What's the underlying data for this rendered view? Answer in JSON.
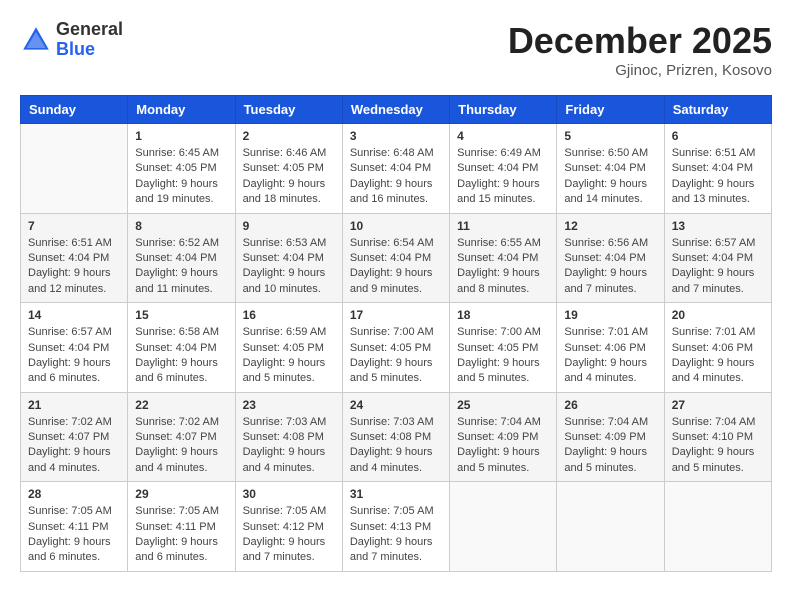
{
  "header": {
    "logo_general": "General",
    "logo_blue": "Blue",
    "month_title": "December 2025",
    "location": "Gjinoc, Prizren, Kosovo"
  },
  "columns": [
    "Sunday",
    "Monday",
    "Tuesday",
    "Wednesday",
    "Thursday",
    "Friday",
    "Saturday"
  ],
  "weeks": [
    [
      {
        "day": "",
        "info": ""
      },
      {
        "day": "1",
        "info": "Sunrise: 6:45 AM\nSunset: 4:05 PM\nDaylight: 9 hours\nand 19 minutes."
      },
      {
        "day": "2",
        "info": "Sunrise: 6:46 AM\nSunset: 4:05 PM\nDaylight: 9 hours\nand 18 minutes."
      },
      {
        "day": "3",
        "info": "Sunrise: 6:48 AM\nSunset: 4:04 PM\nDaylight: 9 hours\nand 16 minutes."
      },
      {
        "day": "4",
        "info": "Sunrise: 6:49 AM\nSunset: 4:04 PM\nDaylight: 9 hours\nand 15 minutes."
      },
      {
        "day": "5",
        "info": "Sunrise: 6:50 AM\nSunset: 4:04 PM\nDaylight: 9 hours\nand 14 minutes."
      },
      {
        "day": "6",
        "info": "Sunrise: 6:51 AM\nSunset: 4:04 PM\nDaylight: 9 hours\nand 13 minutes."
      }
    ],
    [
      {
        "day": "7",
        "info": "Sunrise: 6:51 AM\nSunset: 4:04 PM\nDaylight: 9 hours\nand 12 minutes."
      },
      {
        "day": "8",
        "info": "Sunrise: 6:52 AM\nSunset: 4:04 PM\nDaylight: 9 hours\nand 11 minutes."
      },
      {
        "day": "9",
        "info": "Sunrise: 6:53 AM\nSunset: 4:04 PM\nDaylight: 9 hours\nand 10 minutes."
      },
      {
        "day": "10",
        "info": "Sunrise: 6:54 AM\nSunset: 4:04 PM\nDaylight: 9 hours\nand 9 minutes."
      },
      {
        "day": "11",
        "info": "Sunrise: 6:55 AM\nSunset: 4:04 PM\nDaylight: 9 hours\nand 8 minutes."
      },
      {
        "day": "12",
        "info": "Sunrise: 6:56 AM\nSunset: 4:04 PM\nDaylight: 9 hours\nand 7 minutes."
      },
      {
        "day": "13",
        "info": "Sunrise: 6:57 AM\nSunset: 4:04 PM\nDaylight: 9 hours\nand 7 minutes."
      }
    ],
    [
      {
        "day": "14",
        "info": "Sunrise: 6:57 AM\nSunset: 4:04 PM\nDaylight: 9 hours\nand 6 minutes."
      },
      {
        "day": "15",
        "info": "Sunrise: 6:58 AM\nSunset: 4:04 PM\nDaylight: 9 hours\nand 6 minutes."
      },
      {
        "day": "16",
        "info": "Sunrise: 6:59 AM\nSunset: 4:05 PM\nDaylight: 9 hours\nand 5 minutes."
      },
      {
        "day": "17",
        "info": "Sunrise: 7:00 AM\nSunset: 4:05 PM\nDaylight: 9 hours\nand 5 minutes."
      },
      {
        "day": "18",
        "info": "Sunrise: 7:00 AM\nSunset: 4:05 PM\nDaylight: 9 hours\nand 5 minutes."
      },
      {
        "day": "19",
        "info": "Sunrise: 7:01 AM\nSunset: 4:06 PM\nDaylight: 9 hours\nand 4 minutes."
      },
      {
        "day": "20",
        "info": "Sunrise: 7:01 AM\nSunset: 4:06 PM\nDaylight: 9 hours\nand 4 minutes."
      }
    ],
    [
      {
        "day": "21",
        "info": "Sunrise: 7:02 AM\nSunset: 4:07 PM\nDaylight: 9 hours\nand 4 minutes."
      },
      {
        "day": "22",
        "info": "Sunrise: 7:02 AM\nSunset: 4:07 PM\nDaylight: 9 hours\nand 4 minutes."
      },
      {
        "day": "23",
        "info": "Sunrise: 7:03 AM\nSunset: 4:08 PM\nDaylight: 9 hours\nand 4 minutes."
      },
      {
        "day": "24",
        "info": "Sunrise: 7:03 AM\nSunset: 4:08 PM\nDaylight: 9 hours\nand 4 minutes."
      },
      {
        "day": "25",
        "info": "Sunrise: 7:04 AM\nSunset: 4:09 PM\nDaylight: 9 hours\nand 5 minutes."
      },
      {
        "day": "26",
        "info": "Sunrise: 7:04 AM\nSunset: 4:09 PM\nDaylight: 9 hours\nand 5 minutes."
      },
      {
        "day": "27",
        "info": "Sunrise: 7:04 AM\nSunset: 4:10 PM\nDaylight: 9 hours\nand 5 minutes."
      }
    ],
    [
      {
        "day": "28",
        "info": "Sunrise: 7:05 AM\nSunset: 4:11 PM\nDaylight: 9 hours\nand 6 minutes."
      },
      {
        "day": "29",
        "info": "Sunrise: 7:05 AM\nSunset: 4:11 PM\nDaylight: 9 hours\nand 6 minutes."
      },
      {
        "day": "30",
        "info": "Sunrise: 7:05 AM\nSunset: 4:12 PM\nDaylight: 9 hours\nand 7 minutes."
      },
      {
        "day": "31",
        "info": "Sunrise: 7:05 AM\nSunset: 4:13 PM\nDaylight: 9 hours\nand 7 minutes."
      },
      {
        "day": "",
        "info": ""
      },
      {
        "day": "",
        "info": ""
      },
      {
        "day": "",
        "info": ""
      }
    ]
  ]
}
